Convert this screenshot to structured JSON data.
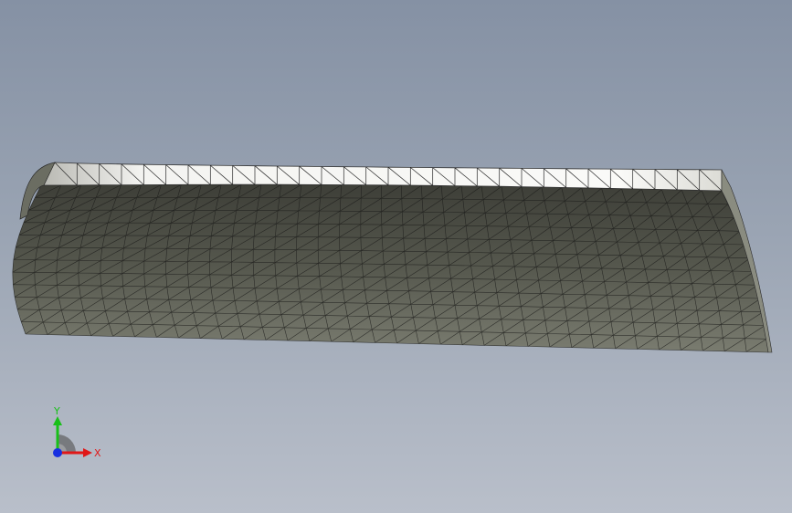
{
  "viewport": {
    "background_top": "#8591a4",
    "background_bottom": "#b9bfca"
  },
  "model": {
    "surface_color": "#55574d",
    "surface_dark": "#3a3b34",
    "edge_highlight": "#f2f2ef",
    "mesh_line_color": "#1a1a18",
    "rows": 12,
    "cols": 34
  },
  "triad": {
    "x_label": "X",
    "y_label": "Y",
    "x_color": "#e01818",
    "y_color": "#18c018",
    "z_color": "#1830e0"
  }
}
